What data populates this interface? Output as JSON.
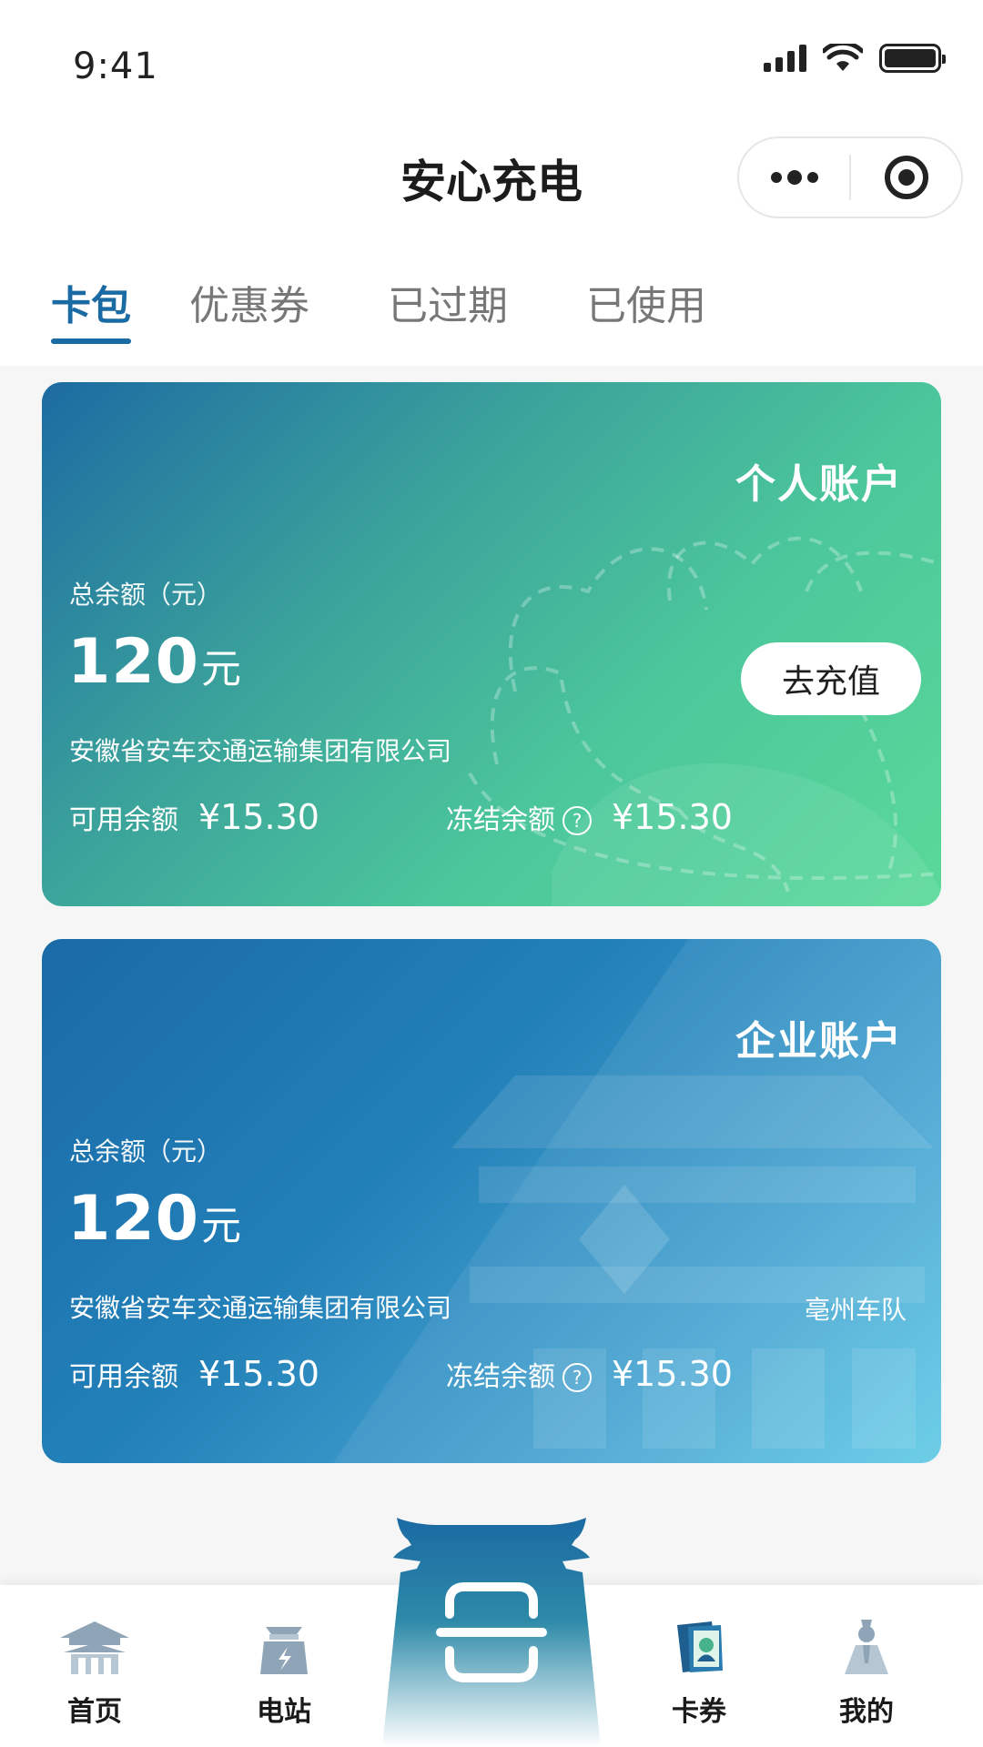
{
  "status_bar": {
    "time": "9:41"
  },
  "header": {
    "title": "安心充电"
  },
  "tabs": [
    {
      "label": "卡包",
      "active": true
    },
    {
      "label": "优惠券",
      "active": false
    },
    {
      "label": "已过期",
      "active": false
    },
    {
      "label": "已使用",
      "active": false
    }
  ],
  "cards": [
    {
      "type_label": "个人账户",
      "balance_label": "总余额（元）",
      "balance_amount": "120",
      "balance_unit": "元",
      "company": "安徽省安车交通运输集团有限公司",
      "available_label": "可用余额",
      "available_value": "¥15.30",
      "frozen_label": "冻结余额",
      "frozen_value": "¥15.30",
      "action_label": "去充值"
    },
    {
      "type_label": "企业账户",
      "balance_label": "总余额（元）",
      "balance_amount": "120",
      "balance_unit": "元",
      "company": "安徽省安车交通运输集团有限公司",
      "fleet": "亳州车队",
      "available_label": "可用余额",
      "available_value": "¥15.30",
      "frozen_label": "冻结余额",
      "frozen_value": "¥15.30"
    }
  ],
  "help_glyph": "?",
  "bottom_nav": [
    {
      "label": "首页",
      "icon": "temple-icon"
    },
    {
      "label": "电站",
      "icon": "power-station-icon"
    },
    {
      "label": "",
      "icon": "scan-icon"
    },
    {
      "label": "卡券",
      "icon": "card-coupon-icon"
    },
    {
      "label": "我的",
      "icon": "profile-figure-icon"
    }
  ],
  "colors": {
    "accent": "#1a6aa3",
    "personal_card_start": "#1c6ba2",
    "personal_card_end": "#5ad99a",
    "enterprise_card_start": "#1a6aa6",
    "enterprise_card_end": "#62cbe6"
  }
}
